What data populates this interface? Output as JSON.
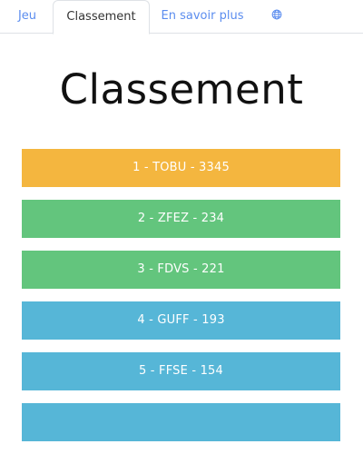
{
  "tabs": [
    {
      "label": "Jeu"
    },
    {
      "label": "Classement"
    },
    {
      "label": "En savoir plus"
    },
    {
      "label": "",
      "icon": "globe-icon"
    }
  ],
  "page": {
    "title": "Classement"
  },
  "ranking": [
    {
      "text": "1 - TOBU - 3345",
      "color": "#f4b63f"
    },
    {
      "text": "2 - ZFEZ - 234",
      "color": "#63c57d"
    },
    {
      "text": "3 - FDVS - 221",
      "color": "#63c57d"
    },
    {
      "text": "4 - GUFF - 193",
      "color": "#56b6d7"
    },
    {
      "text": "5 - FFSE - 154",
      "color": "#56b6d7"
    },
    {
      "text": "",
      "color": "#56b6d7"
    }
  ],
  "colors": {
    "link": "#5b8def",
    "gold": "#f4b63f",
    "green": "#63c57d",
    "blue": "#56b6d7"
  }
}
